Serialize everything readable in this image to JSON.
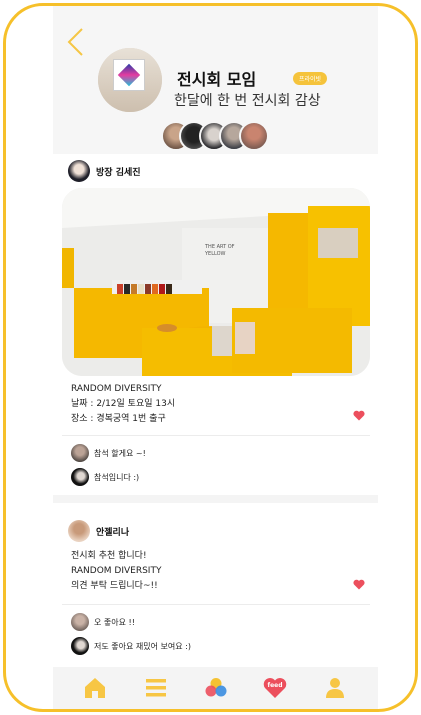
{
  "group": {
    "title": "전시회 모임",
    "badge": "프라이빗",
    "description": "한달에 한 번 전시회 감상",
    "members": [
      "member-1",
      "member-2",
      "member-3",
      "member-4",
      "member-5"
    ]
  },
  "posts": [
    {
      "author_role": "방장",
      "author_name": "김세진",
      "author_label": "방장 김세진",
      "lines": [
        "RANDOM DIVERSITY",
        "날짜 : 2/12일 토요일 13시",
        "장소 : 경복궁역 1번 출구"
      ],
      "photo_text": "THE ART OF YELLOW",
      "comments": [
        "참석 할게요 ~!",
        "참석입니다 :)"
      ]
    },
    {
      "author_label": "안젤리나",
      "lines": [
        "전시회 추천 합니다!",
        "RANDOM DIVERSITY",
        "의견 부탁 드립니다~!!"
      ],
      "comments": [
        "오 좋아요 !!",
        "저도 좋아요 재밌어 보여요 :)"
      ]
    }
  ],
  "tabbar": {
    "items": [
      "home-icon",
      "menu-icon",
      "circles-icon",
      "feed-icon",
      "profile-icon"
    ],
    "feed_label": "feed"
  },
  "colors": {
    "accent": "#f6c02a",
    "heart": "#ec4f5d",
    "tab_icon": "#f7c644"
  }
}
